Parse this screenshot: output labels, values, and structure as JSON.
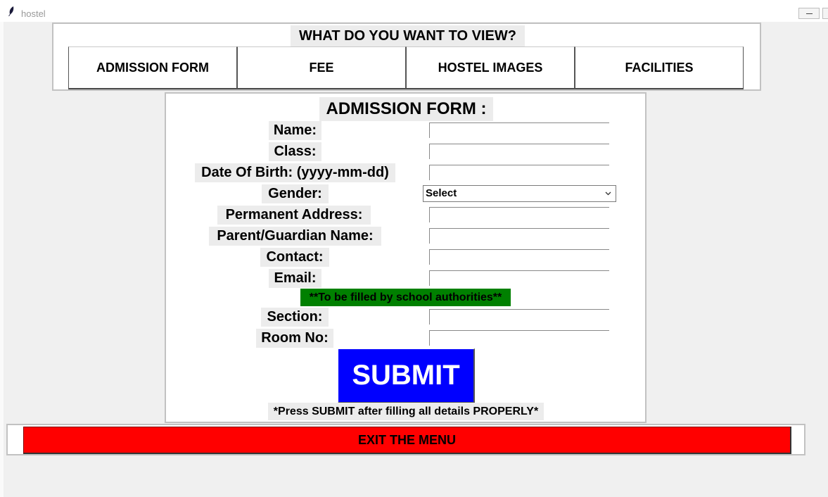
{
  "window": {
    "title": "hostel",
    "icon": "feather-icon"
  },
  "view_menu": {
    "heading": "WHAT DO YOU WANT TO VIEW?",
    "buttons": [
      "ADMISSION FORM",
      "FEE",
      "HOSTEL IMAGES",
      "FACILITIES"
    ]
  },
  "form": {
    "title": "ADMISSION FORM :",
    "labels": {
      "name": "Name:",
      "class": "Class:",
      "dob": "Date Of Birth: (yyyy-mm-dd)",
      "gender": "Gender:",
      "address": "Permanent Address:",
      "guardian": "Parent/Guardian Name:",
      "contact": "Contact:",
      "email": "Email:",
      "section": "Section:",
      "room": "Room No:"
    },
    "values": {
      "name": "",
      "class": "",
      "dob": "",
      "address": "",
      "guardian": "",
      "contact": "",
      "email": "",
      "section": "",
      "room": ""
    },
    "gender_selected": "Select",
    "authority_note": "**To be filled by school authorities**",
    "submit_label": "SUBMIT",
    "press_note": "*Press SUBMIT after filling all details PROPERLY*"
  },
  "exit_label": "EXIT THE MENU",
  "colors": {
    "submit_bg": "#0000ff",
    "exit_bg": "#ff0000",
    "note_bg": "#008000",
    "label_bg": "#ececec"
  }
}
